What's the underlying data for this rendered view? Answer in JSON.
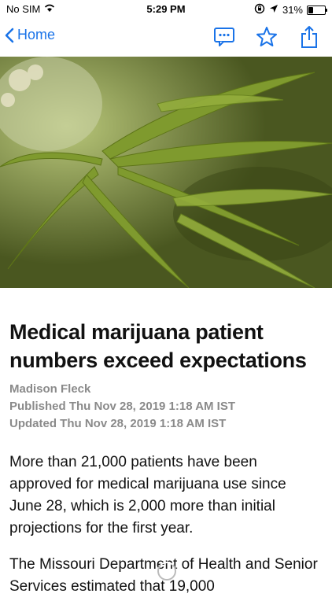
{
  "status": {
    "carrier": "No SIM",
    "time": "5:29 PM",
    "battery": "31%",
    "battery_level": 0.31,
    "icons": [
      "wifi-icon",
      "rotation-lock-icon",
      "location-arrow-icon",
      "battery-icon"
    ]
  },
  "nav": {
    "back_label": "Home",
    "icons": [
      "comment-icon",
      "star-icon",
      "share-icon"
    ],
    "accent": "#1a73e8"
  },
  "article": {
    "title": "Medical marijuana patient numbers exceed expectations",
    "author": "Madison Fleck",
    "published": "Published Thu Nov 28, 2019 1:18 AM IST",
    "updated": "Updated Thu Nov 28, 2019 1:18 AM IST",
    "paragraphs": [
      "More than 21,000 patients have been approved for medical marijuana use since June 28, which is 2,000 more than initial projections for the first year.",
      "The Missouri Department of Health and Senior Services estimated that 19,000"
    ]
  }
}
